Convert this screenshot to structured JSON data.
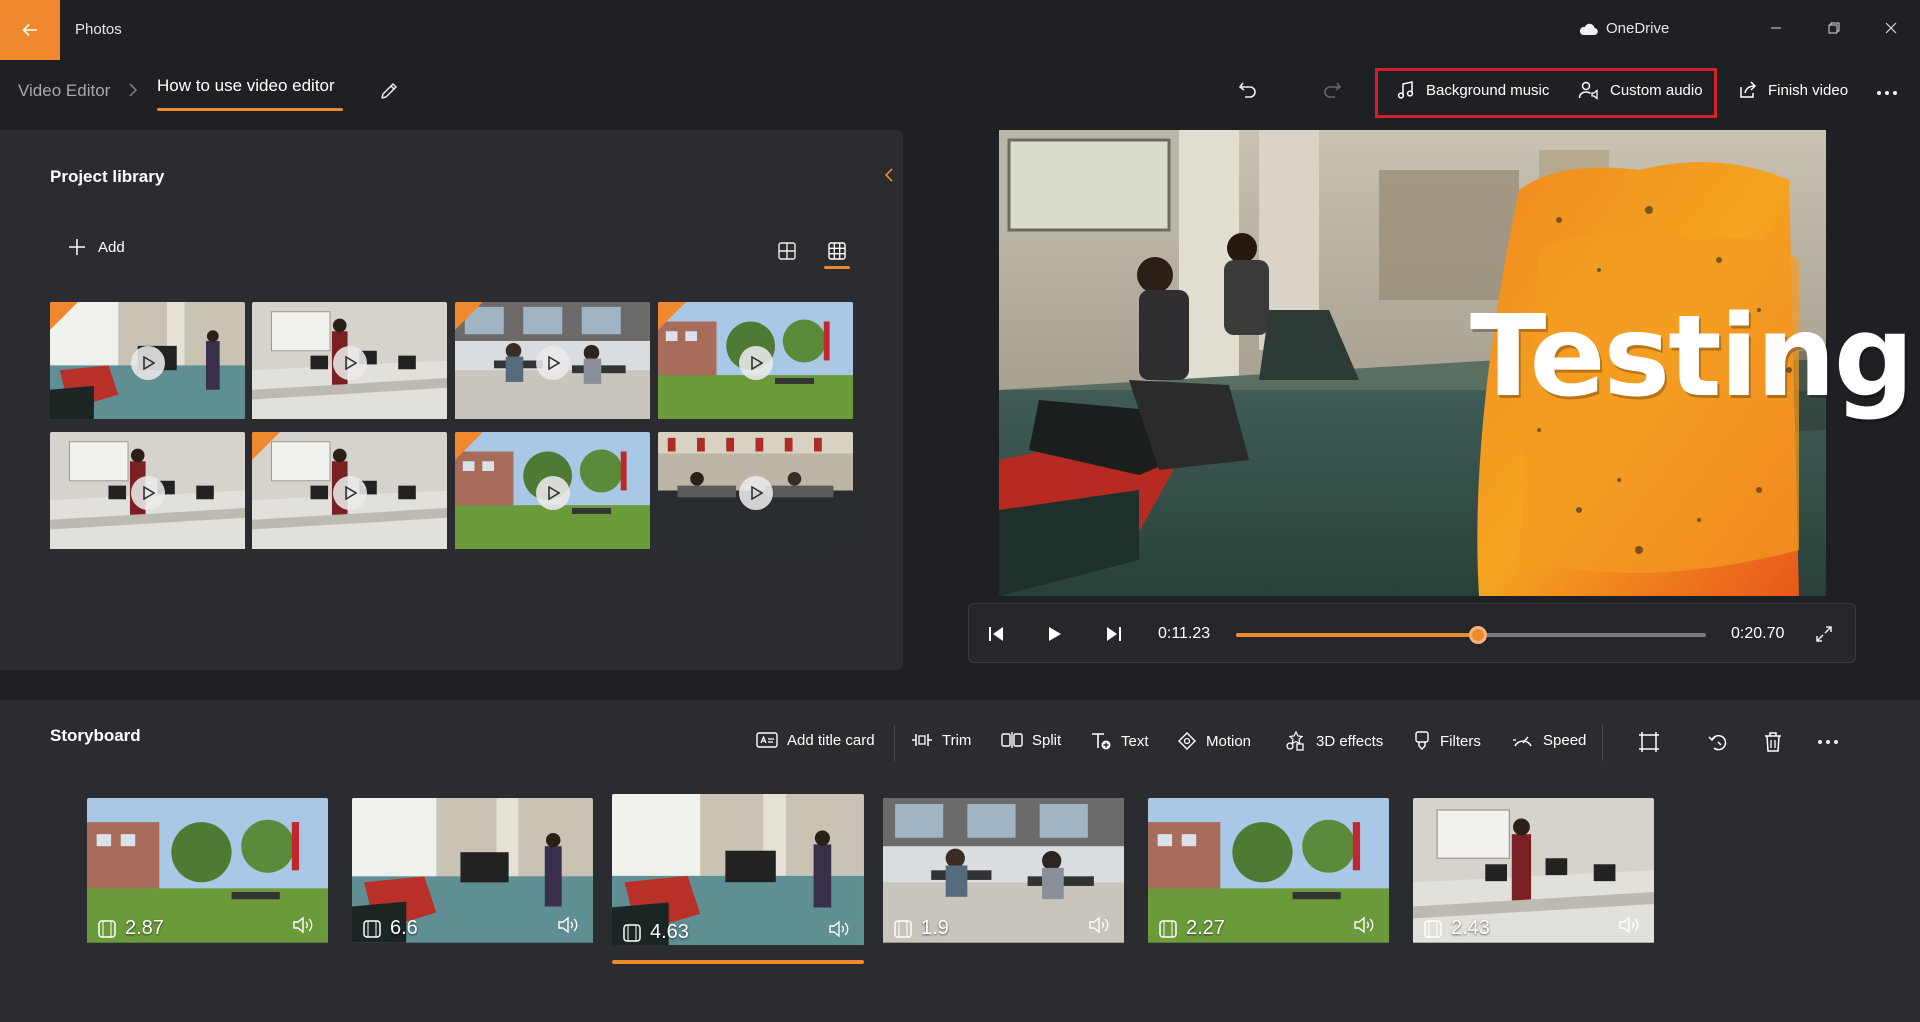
{
  "app": {
    "title": "Photos",
    "cloud_label": "OneDrive"
  },
  "breadcrumb": {
    "root": "Video Editor",
    "current": "How to use video editor"
  },
  "toolbar": {
    "background_music": "Background music",
    "custom_audio": "Custom audio",
    "finish_video": "Finish video"
  },
  "library": {
    "title": "Project library",
    "add_label": "Add",
    "thumbnails": [
      {
        "scene": "lounge",
        "in_use": true
      },
      {
        "scene": "lab",
        "in_use": false
      },
      {
        "scene": "patio",
        "in_use": true
      },
      {
        "scene": "campus",
        "in_use": true
      },
      {
        "scene": "lab",
        "in_use": false
      },
      {
        "scene": "lab",
        "in_use": true
      },
      {
        "scene": "campus",
        "in_use": true
      },
      {
        "scene": "hall",
        "in_use": false
      }
    ]
  },
  "preview": {
    "title_text": "Testing",
    "current_time": "0:11.23",
    "total_time": "0:20.70",
    "progress": 0.515
  },
  "storyboard": {
    "title": "Storyboard",
    "tools": {
      "add_title_card": "Add title card",
      "trim": "Trim",
      "split": "Split",
      "text": "Text",
      "motion": "Motion",
      "effects_3d": "3D effects",
      "filters": "Filters",
      "speed": "Speed"
    },
    "clips": [
      {
        "duration": "2.87",
        "scene": "campus"
      },
      {
        "duration": "6.6",
        "scene": "lounge"
      },
      {
        "duration": "4.63",
        "scene": "lounge",
        "selected": true
      },
      {
        "duration": "1.9",
        "scene": "patio"
      },
      {
        "duration": "2.27",
        "scene": "campus"
      },
      {
        "duration": "2.43",
        "scene": "lab"
      }
    ]
  },
  "colors": {
    "accent": "#f0892d",
    "highlight": "#d4202c",
    "panel": "#2b2c30",
    "background": "#1f2024"
  }
}
